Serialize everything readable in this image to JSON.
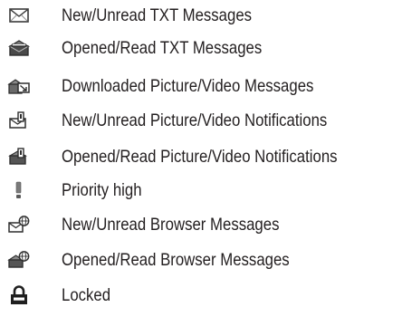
{
  "legend": {
    "items": [
      {
        "icon": "new-unread-txt-message-icon",
        "label": "New/Unread TXT Messages"
      },
      {
        "icon": "opened-read-txt-message-icon",
        "label": "Opened/Read TXT Messages"
      },
      {
        "icon": "downloaded-picture-video-message-icon",
        "label": "Downloaded Picture/Video Messages"
      },
      {
        "icon": "new-unread-picture-video-notification-icon",
        "label": "New/Unread Picture/Video Notifications"
      },
      {
        "icon": "opened-read-picture-video-notification-icon",
        "label": "Opened/Read Picture/Video Notifications"
      },
      {
        "icon": "priority-high-icon",
        "label": "Priority high"
      },
      {
        "icon": "new-unread-browser-message-icon",
        "label": "New/Unread Browser Messages"
      },
      {
        "icon": "opened-read-browser-message-icon",
        "label": "Opened/Read Browser Messages"
      },
      {
        "icon": "locked-icon",
        "label": "Locked"
      }
    ]
  }
}
